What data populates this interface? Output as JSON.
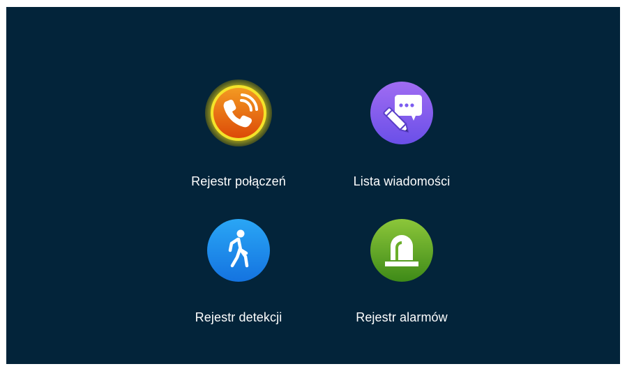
{
  "menu": {
    "items": [
      {
        "label": "Rejestr połączeń",
        "icon": "phone-call-icon",
        "color": "#e8590c",
        "selected": true
      },
      {
        "label": "Lista wiadomości",
        "icon": "message-pencil-icon",
        "color": "#7b5cf0",
        "selected": false
      },
      {
        "label": "Rejestr detekcji",
        "icon": "walking-person-icon",
        "color": "#1e8fef",
        "selected": false
      },
      {
        "label": "Rejestr alarmów",
        "icon": "alarm-siren-icon",
        "color": "#5aa22a",
        "selected": false
      }
    ]
  },
  "colors": {
    "background": "#03243a",
    "selection_glow": "#d8c81c"
  }
}
